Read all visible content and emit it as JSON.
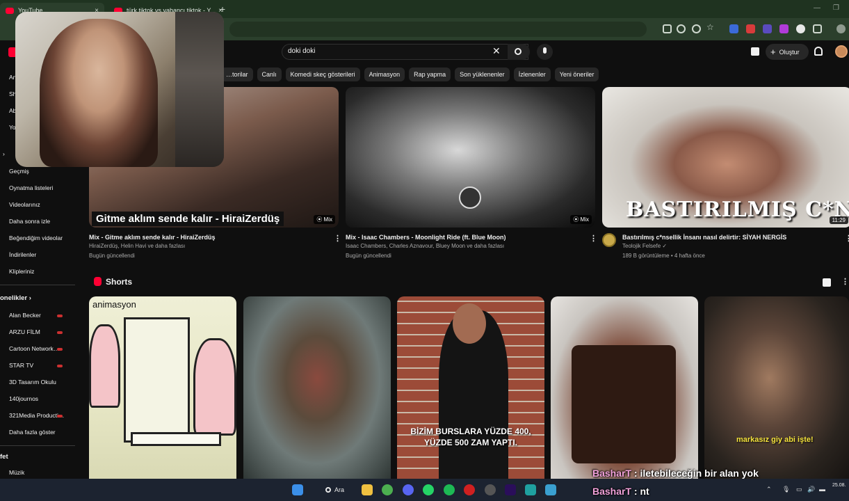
{
  "browser": {
    "tabs": [
      {
        "title": "YouTube",
        "close": "×"
      },
      {
        "title": "türk tiktok vs yabancı tiktok - Y",
        "close": "×"
      }
    ],
    "new_tab": "+"
  },
  "youtube": {
    "search_query": "doki doki",
    "clear": "✕",
    "create_label": "Oluştur",
    "chips": [
      "…torilar",
      "Canlı",
      "Komedi skeç gösterileri",
      "Animasyon",
      "Rap yapma",
      "Son yüklenenler",
      "İzlenenler",
      "Yeni öneriler"
    ]
  },
  "sidebar": {
    "partial_items": [
      "An",
      "Sh",
      "Ab",
      "Yo"
    ],
    "you_items": [
      "Geçmiş",
      "Oynatma listeleri",
      "Videolarınız",
      "Daha sonra izle",
      "Beğendiğim videolar",
      "İndirilenler",
      "Klipleriniz"
    ],
    "subs_heading": "Abonelikler",
    "subs_heading_visible": "onelikler",
    "subs": [
      "Alan Becker",
      "ARZU FİLM",
      "Cartoon Network…",
      "STAR TV",
      "3D Tasarım Okulu",
      "140journos",
      "321Media Producti…",
      "Daha fazla göster"
    ],
    "explore_heading": "fet",
    "explore_items": [
      "Müzik"
    ]
  },
  "videos": [
    {
      "title": "Mix - Gitme aklım sende kalır - HiraiZerdüş",
      "meta1": "HiraiZerdüş, Helin Havi ve daha fazlası",
      "meta2": "Bugün güncellendi",
      "thumb_caption": "Gitme aklım sende kalır - HiraiZerdüş",
      "badge": "⦿ Mix"
    },
    {
      "title": "Mix - Isaac Chambers - Moonlight Ride (ft. Blue Moon)",
      "meta1": "Isaac Chambers, Charles Aznavour, Bluey Moon ve daha fazlası",
      "meta2": "Bugün güncellendi",
      "badge": "⦿ Mix"
    },
    {
      "title": "Bastırılmış c*nsellik İnsanı nasıl delirtir: SİYAH NERGİS",
      "meta1": "Teolojik Felsefe ✓",
      "meta2": "189 B görüntüleme • 4 hafta önce",
      "thumb_caption": "BASTIRILMIŞ  C*NSELLİK",
      "badge": "11:29"
    }
  ],
  "shorts": {
    "title": "Shorts",
    "s1_label": "animasyon",
    "s3_subtitle": "BİZİM BURSLARA YÜZDE 400, YÜZDE 500 ZAM YAPTI.",
    "s5_subtitle": "markasız giy abi işte!"
  },
  "chat": [
    {
      "name": "BasharT",
      "message": " : iletebileceğin bir alan yok"
    },
    {
      "name": "BasharT",
      "message": " : nt"
    }
  ],
  "taskbar": {
    "search_label": "Ara",
    "date": "25.08."
  },
  "colors": {
    "youtube_red": "#ff0033",
    "background": "#0f0f0f",
    "chip": "#272727",
    "browser_frame": "#2b3f2c",
    "chat_name": "#f0a0d8"
  }
}
